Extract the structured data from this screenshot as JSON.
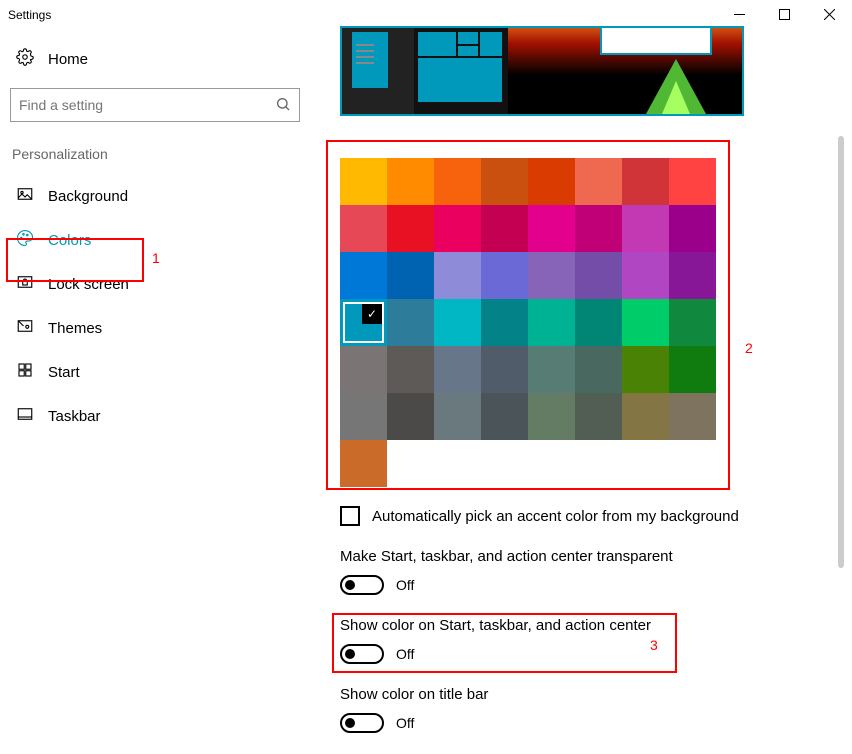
{
  "window": {
    "title": "Settings"
  },
  "sidebar": {
    "home": "Home",
    "search_placeholder": "Find a setting",
    "section": "Personalization",
    "items": [
      {
        "label": "Background"
      },
      {
        "label": "Colors"
      },
      {
        "label": "Lock screen"
      },
      {
        "label": "Themes"
      },
      {
        "label": "Start"
      },
      {
        "label": "Taskbar"
      }
    ]
  },
  "annotations": {
    "n1": "1",
    "n2": "2",
    "n3": "3"
  },
  "palette": {
    "rows": [
      [
        "#ffb900",
        "#ff8c00",
        "#f7630c",
        "#ca5010",
        "#da3b01",
        "#ef6950",
        "#d13438",
        "#ff4343"
      ],
      [
        "#e74856",
        "#e81123",
        "#ea005e",
        "#c30052",
        "#e3008c",
        "#bf0077",
        "#c239b3",
        "#9a0089"
      ],
      [
        "#0078d7",
        "#0063b1",
        "#8e8cd8",
        "#6b69d6",
        "#8764b8",
        "#744da9",
        "#b146c2",
        "#881798"
      ],
      [
        "#0099bc",
        "#2d7d9a",
        "#00b7c3",
        "#038387",
        "#00b294",
        "#018574",
        "#00cc6a",
        "#10893e"
      ],
      [
        "#7a7574",
        "#5d5a58",
        "#68768a",
        "#515c6b",
        "#567c73",
        "#486860",
        "#498205",
        "#107c10"
      ],
      [
        "#767676",
        "#4c4a48",
        "#69797e",
        "#4a5459",
        "#647c64",
        "#525e54",
        "#847545",
        "#7e735f"
      ],
      [
        "#ca6b2a"
      ]
    ],
    "selected": {
      "row": 3,
      "col": 0
    }
  },
  "checkbox": {
    "label": "Automatically pick an accent color from my background"
  },
  "options": [
    {
      "label": "Make Start, taskbar, and action center transparent",
      "state": "Off"
    },
    {
      "label": "Show color on Start, taskbar, and action center",
      "state": "Off"
    },
    {
      "label": "Show color on title bar",
      "state": "Off"
    }
  ]
}
